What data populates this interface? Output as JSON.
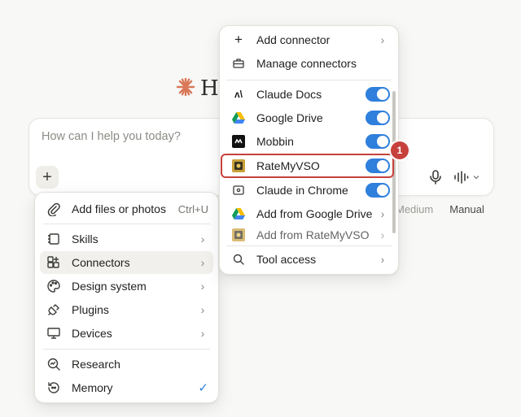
{
  "greeting": {
    "text": "He"
  },
  "composer": {
    "placeholder": "How can I help you today?"
  },
  "chips": {
    "medium": "Medium",
    "manual": "Manual"
  },
  "left_menu": {
    "add_files": {
      "label": "Add files or photos",
      "shortcut": "Ctrl+U"
    },
    "items": [
      {
        "label": "Skills"
      },
      {
        "label": "Connectors"
      },
      {
        "label": "Design system"
      },
      {
        "label": "Plugins"
      },
      {
        "label": "Devices"
      }
    ],
    "research": "Research",
    "memory": "Memory"
  },
  "right_menu": {
    "add_connector": "Add connector",
    "manage_connectors": "Manage connectors",
    "connectors": [
      {
        "label": "Claude Docs",
        "enabled": true
      },
      {
        "label": "Google Drive",
        "enabled": true
      },
      {
        "label": "Mobbin",
        "enabled": true
      },
      {
        "label": "RateMyVSO",
        "enabled": true
      },
      {
        "label": "Claude in Chrome",
        "enabled": true
      }
    ],
    "add_from_google_drive": "Add from Google Drive",
    "add_from_ratemyvso": "Add from RateMyVSO",
    "tool_access": "Tool access"
  },
  "annotation": {
    "badge": "1"
  },
  "colors": {
    "accent": "#2f7fdc",
    "highlight": "#c7413c",
    "brand": "#d97757"
  }
}
